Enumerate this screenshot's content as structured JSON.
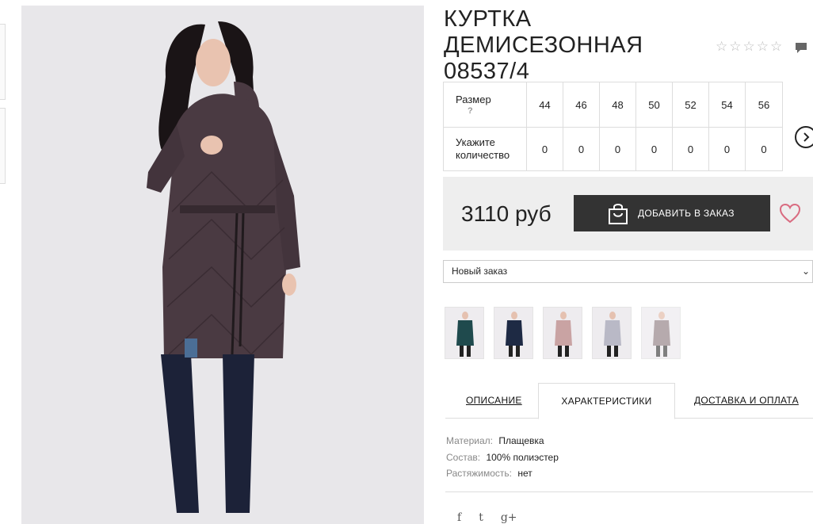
{
  "product": {
    "title": "КУРТКА ДЕМИСЕЗОННАЯ 08537/4",
    "rating_stars": [
      "☆",
      "☆",
      "☆",
      "☆",
      "☆"
    ],
    "rating_value": 0,
    "main_image_icon": "coat-photo"
  },
  "size_table": {
    "size_label": "Размер",
    "help_mark": "?",
    "qty_label": "Укажите количество",
    "sizes": [
      "44",
      "46",
      "48",
      "50",
      "52",
      "54",
      "56"
    ],
    "quantities": [
      "0",
      "0",
      "0",
      "0",
      "0",
      "0",
      "0"
    ]
  },
  "buy": {
    "price": "3110 руб",
    "add_label": "ДОБАВИТЬ В ЗАКАЗ"
  },
  "order_select": {
    "value": "Новый заказ"
  },
  "swatches": [
    {
      "color": "#1f4a4d"
    },
    {
      "color": "#1e2a44"
    },
    {
      "color": "#c9a3a3"
    },
    {
      "color": "#b9b9c6"
    },
    {
      "color": "#9e8e92"
    }
  ],
  "tabs": [
    "ОПИСАНИЕ",
    "ХАРАКТЕРИСТИКИ",
    "ДОСТАВКА И ОПЛАТА"
  ],
  "active_tab": 1,
  "specs": [
    {
      "key": "Материал:",
      "value": "Плащевка"
    },
    {
      "key": "Состав:",
      "value": "100% полиэстер"
    },
    {
      "key": "Растяжимость:",
      "value": "нет"
    }
  ],
  "share": [
    "f",
    "t",
    "g+"
  ],
  "colors": {
    "button_bg": "#333333",
    "panel_bg": "#eeeeee",
    "heart": "#d96b80",
    "coat": "#4a3a42"
  }
}
